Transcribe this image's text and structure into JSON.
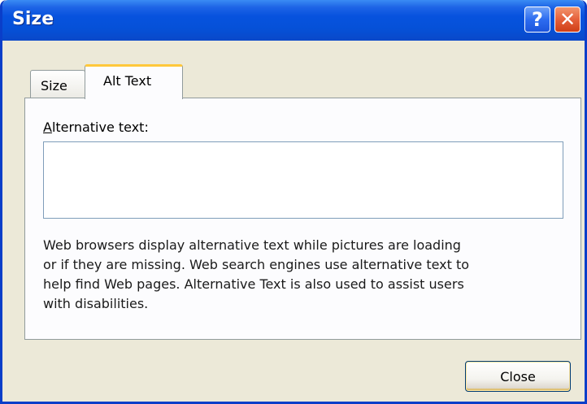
{
  "window": {
    "title": "Size",
    "help_glyph": "?",
    "close_glyph": "✕"
  },
  "tabs": [
    {
      "label": "Size",
      "selected": false
    },
    {
      "label": "Alt Text",
      "selected": true
    }
  ],
  "alt_text": {
    "label_access_key": "A",
    "label_rest": "lternative text:",
    "value": "",
    "description": "Web browsers display alternative text while pictures are loading\nor if they are missing.  Web search engines use alternative text to\nhelp find Web pages.  Alternative Text is also used to assist users\nwith disabilities."
  },
  "footer": {
    "close_label": "Close"
  },
  "colors": {
    "titlebar": "#0752de",
    "dialog_bg": "#ece9d8",
    "selected_tab_accent": "#ffc83c",
    "close_button_title": "#e5603a"
  }
}
